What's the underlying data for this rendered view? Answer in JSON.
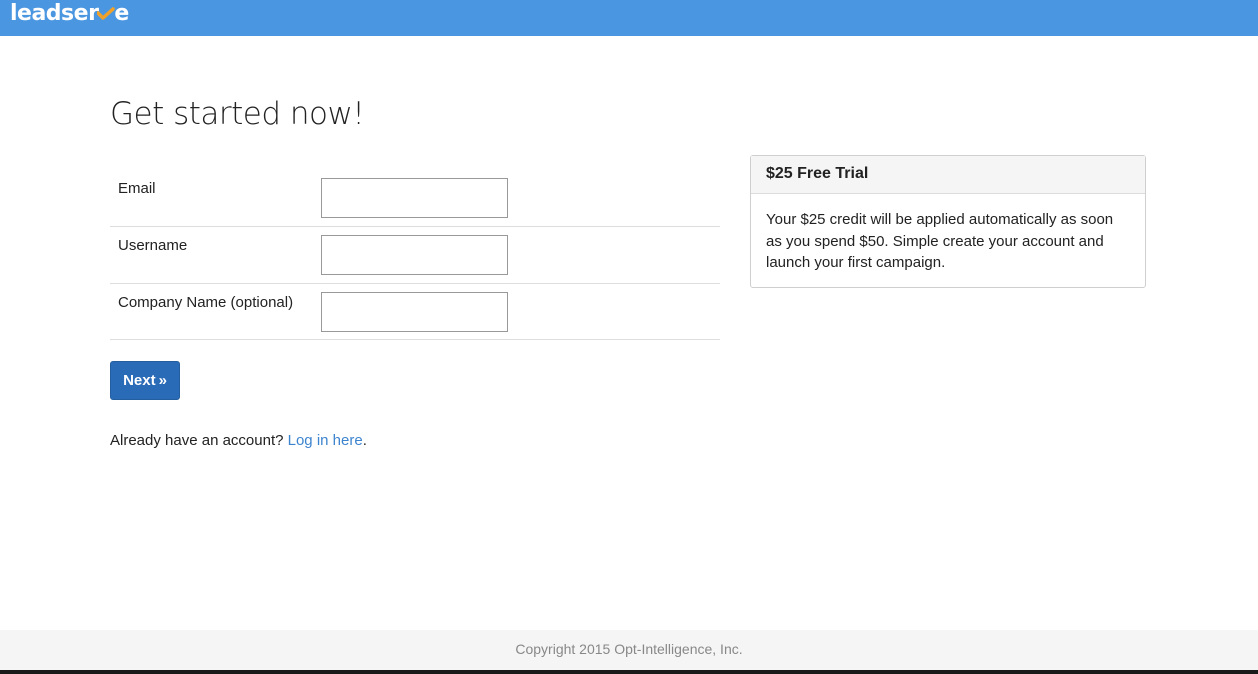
{
  "header": {
    "logo_text_pre": "leadser",
    "logo_text_post": "e",
    "logo_accent_color": "#f0a12a",
    "bar_color": "#4a96e0"
  },
  "main": {
    "title": "Get started now!",
    "fields": [
      {
        "label": "Email",
        "value": "",
        "placeholder": ""
      },
      {
        "label": "Username",
        "value": "",
        "placeholder": ""
      },
      {
        "label": "Company Name (optional)",
        "value": "",
        "placeholder": ""
      }
    ],
    "next_button": {
      "label": "Next",
      "glyph": "»"
    },
    "login": {
      "prefix": "Already have an account? ",
      "link_text": "Log in here",
      "suffix": "."
    }
  },
  "trial_panel": {
    "heading": "$25 Free Trial",
    "body": "Your $25 credit will be applied automatically as soon as you spend $50. Simple create your account and launch your first campaign."
  },
  "footer": {
    "copyright": "Copyright 2015 Opt-Intelligence, Inc."
  },
  "colors": {
    "primary_button": "#2a6bb8",
    "link": "#3d84cf"
  }
}
